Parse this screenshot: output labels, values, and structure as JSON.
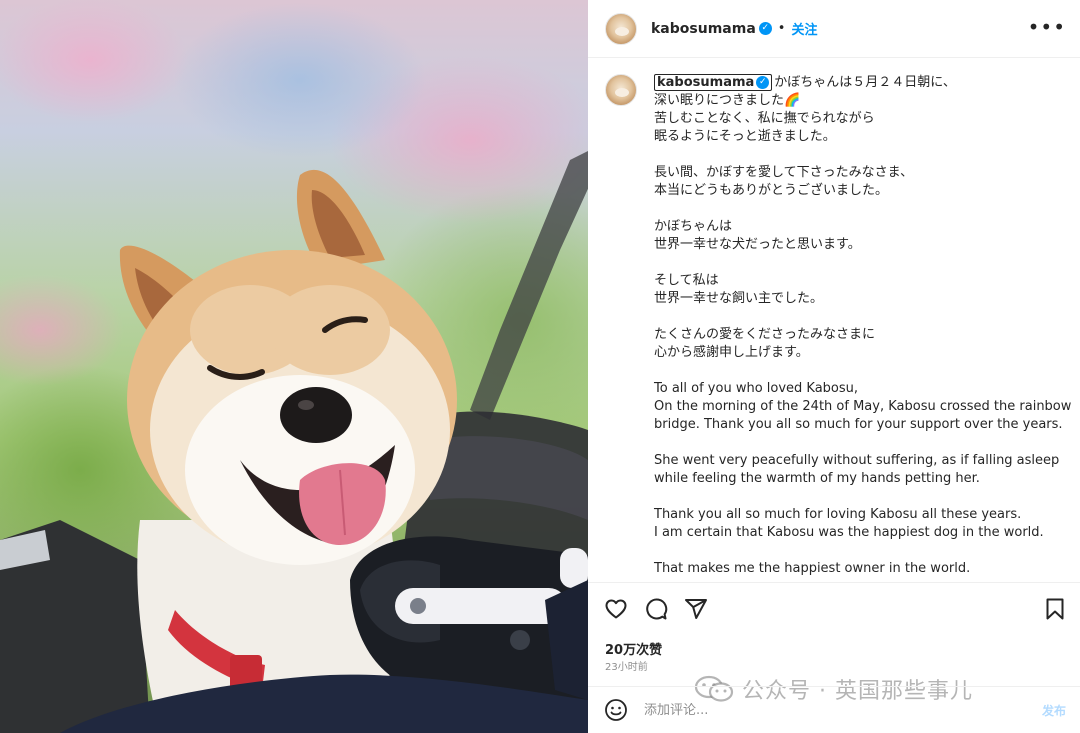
{
  "photo": {
    "subject": "shiba-inu-smiling"
  },
  "header": {
    "username": "kabosumama",
    "verified_glyph": "✓",
    "separator": "•",
    "follow_label": "关注",
    "more_glyph": "•••"
  },
  "caption": {
    "username": "kabosumama",
    "verified_glyph": "✓",
    "text": "かぼちゃんは５月２４日朝に、\n深い眠りにつきました🌈\n苦しむことなく、私に撫でられながら\n眠るようにそっと逝きました。\n\n長い間、かぼすを愛して下さったみなさま、\n本当にどうもありがとうございました。\n\nかぼちゃんは\n世界一幸せな犬だったと思います。\n\nそして私は\n世界一幸せな飼い主でした。\n\nたくさんの愛をくださったみなさまに\n心から感謝申し上げます。\n\nTo all of you who loved Kabosu,\nOn the morning of the 24th of May, Kabosu crossed the rainbow bridge. Thank you all so much for your support over the years.\n\nShe went very peacefully without suffering, as if falling asleep while feeling the warmth of my hands petting her.\n\nThank you all so much for loving Kabosu all these years.\nI am certain that Kabosu was the happiest dog in the world.\n\nThat makes me the happiest owner in the world."
  },
  "actions": {
    "icons": [
      "heart-icon",
      "comment-icon",
      "share-icon",
      "bookmark-icon"
    ],
    "likes": "20万次赞",
    "time": "23小时前"
  },
  "watermark": {
    "text": "公众号 · 英国那些事儿"
  },
  "comment": {
    "placeholder": "添加评论...",
    "post_label": "发布"
  },
  "colors": {
    "accent": "#0095f6",
    "text": "#262626",
    "muted": "#8e8e8e",
    "border": "#efefef"
  }
}
